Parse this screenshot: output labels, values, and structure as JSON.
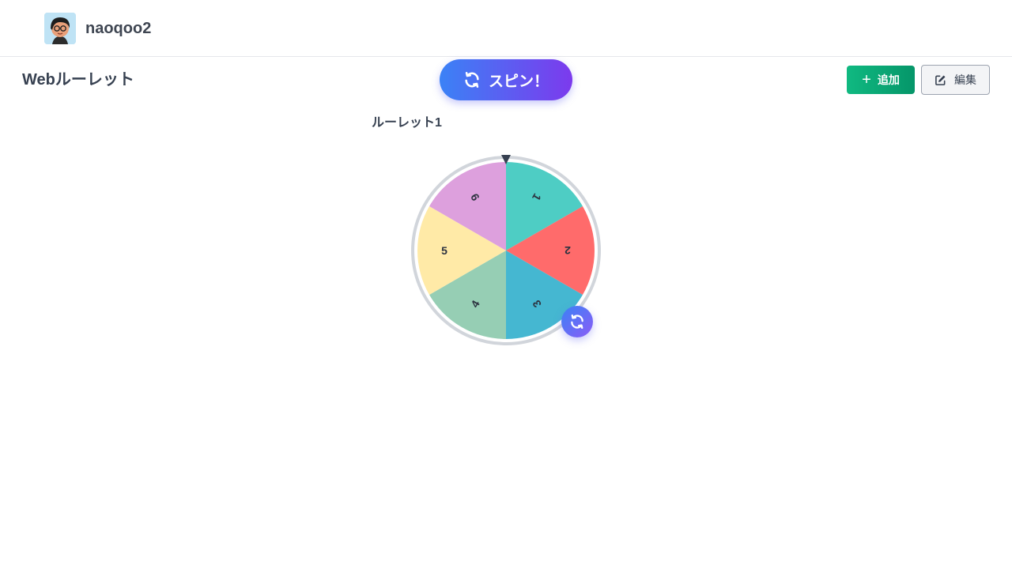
{
  "header": {
    "username": "naoqoo2"
  },
  "page": {
    "title": "Webルーレット"
  },
  "toolbar": {
    "spin_label": "スピン！",
    "add_label": "追加",
    "edit_label": "編集"
  },
  "roulette": {
    "name": "ルーレット1",
    "segments": [
      {
        "label": "1",
        "color": "#4ecdc4"
      },
      {
        "label": "2",
        "color": "#ff6b6b"
      },
      {
        "label": "3",
        "color": "#45b7d1"
      },
      {
        "label": "4",
        "color": "#96ceb4"
      },
      {
        "label": "5",
        "color": "#ffeaa7"
      },
      {
        "label": "6",
        "color": "#dda0dd"
      }
    ]
  },
  "colors": {
    "spin_gradient_start": "#3b82f6",
    "spin_gradient_end": "#7c3aed",
    "add_green": "#10b981",
    "text_dark": "#374151"
  }
}
